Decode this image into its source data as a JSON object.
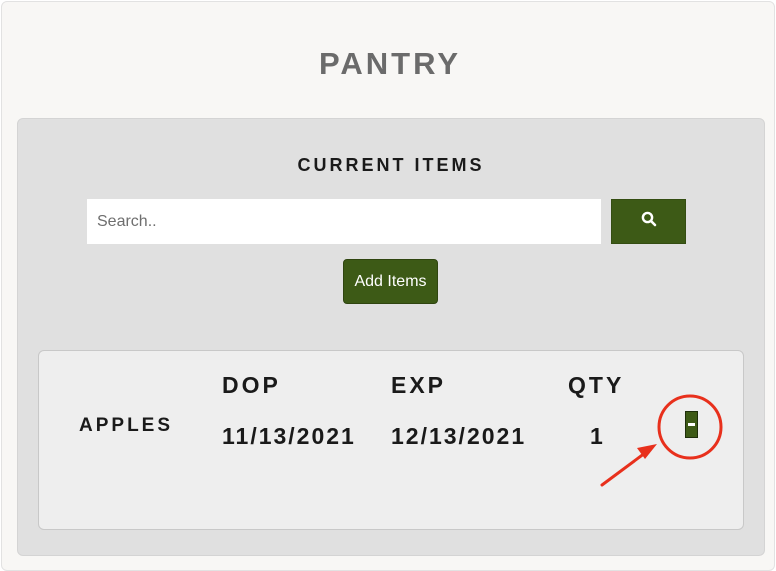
{
  "header": {
    "title": "PANTRY"
  },
  "panel": {
    "title": "CURRENT ITEMS",
    "search": {
      "placeholder": "Search..",
      "value": ""
    },
    "add_button_label": "Add Items"
  },
  "table": {
    "columns": [
      "DOP",
      "EXP",
      "QTY"
    ],
    "rows": [
      {
        "name": "APPLES",
        "dop": "11/13/2021",
        "exp": "12/13/2021",
        "qty": "1"
      }
    ]
  },
  "icons": {
    "search": "search-icon"
  },
  "colors": {
    "accent": "#3d5a16",
    "annotation": "#e8301c"
  }
}
